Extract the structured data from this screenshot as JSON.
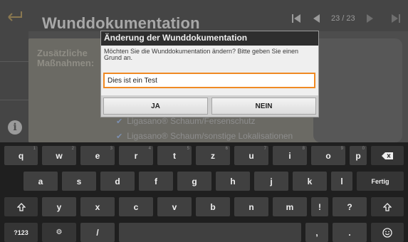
{
  "app": {
    "title": "Wunddokumentation",
    "page_counter": "23 / 23",
    "section_label": "Zusätzliche Maßnahmen:",
    "checklist": [
      "Ligasano® Schaum/Fersenschutz",
      "Ligasano® Schaum/sonstige Lokalisationen"
    ]
  },
  "dialog": {
    "title": "Änderung der Wunddokumentation",
    "message": "Möchten Sie die Wunddokumentation ändern? Bitte geben Sie einen Grund an.",
    "input_value": "Dies ist ein Test",
    "yes_label": "JA",
    "no_label": "NEIN"
  },
  "keyboard": {
    "row1": [
      {
        "label": "q",
        "hint": "1"
      },
      {
        "label": "w",
        "hint": "2"
      },
      {
        "label": "e",
        "hint": "3"
      },
      {
        "label": "r",
        "hint": "4"
      },
      {
        "label": "t",
        "hint": "5"
      },
      {
        "label": "z",
        "hint": "6"
      },
      {
        "label": "u",
        "hint": "7"
      },
      {
        "label": "i",
        "hint": "8"
      },
      {
        "label": "o",
        "hint": "9"
      },
      {
        "label": "p",
        "hint": "0"
      }
    ],
    "row2": [
      "a",
      "s",
      "d",
      "f",
      "g",
      "h",
      "j",
      "k",
      "l"
    ],
    "done_label": "Fertig",
    "row3": [
      "y",
      "x",
      "c",
      "v",
      "b",
      "n",
      "m",
      "!",
      "?"
    ],
    "symbols_label": "?123",
    "settings_label": "⚙",
    "slash_label": "/",
    "comma_label": ",",
    "period_label": "."
  },
  "colors": {
    "accent_input_border": "#f08a24",
    "dialog_title_bg": "#2e2e2e",
    "keyboard_bg": "#1f1f1f",
    "key_bg": "#404040"
  }
}
